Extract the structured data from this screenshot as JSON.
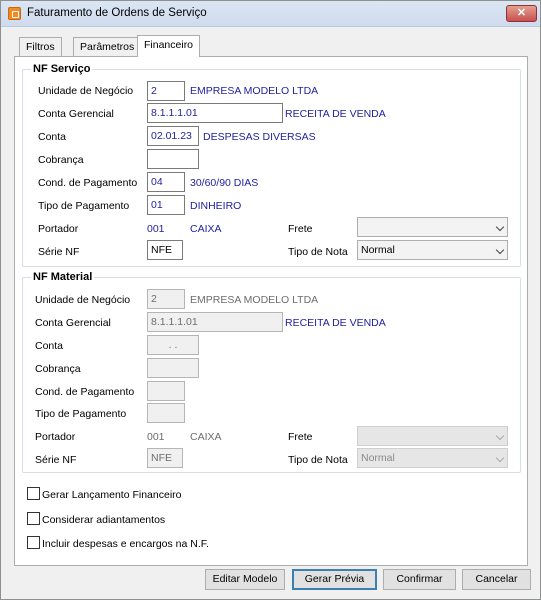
{
  "window": {
    "title": "Faturamento de Ordens de Serviço",
    "close_label": "✕"
  },
  "tabs": [
    {
      "label": "Filtros"
    },
    {
      "label": "Parâmetros"
    },
    {
      "label": "Financeiro",
      "active": true
    }
  ],
  "nf_servico": {
    "title": "NF Serviço",
    "unidade_label": "Unidade de Negócio",
    "unidade_value": "2",
    "unidade_desc": "EMPRESA MODELO LTDA",
    "conta_gerencial_label": "Conta Gerencial",
    "conta_gerencial_value": "8.1.1.1.01",
    "conta_gerencial_desc": "RECEITA DE VENDA",
    "conta_label": "Conta",
    "conta_value": "02.01.23",
    "conta_desc": "DESPESAS DIVERSAS",
    "cobranca_label": "Cobrança",
    "cobranca_value": "",
    "cond_pag_label": "Cond. de Pagamento",
    "cond_pag_value": "04",
    "cond_pag_desc": "30/60/90 DIAS",
    "tipo_pag_label": "Tipo de Pagamento",
    "tipo_pag_value": "01",
    "tipo_pag_desc": "DINHEIRO",
    "portador_label": "Portador",
    "portador_value": "001",
    "portador_desc": "CAIXA",
    "frete_label": "Frete",
    "frete_value": "",
    "serie_label": "Série NF",
    "serie_value": "NFE",
    "tipo_nota_label": "Tipo de Nota",
    "tipo_nota_value": "Normal"
  },
  "nf_material": {
    "title": "NF Material",
    "unidade_label": "Unidade de Negócio",
    "unidade_value": "2",
    "unidade_desc": "EMPRESA MODELO LTDA",
    "conta_gerencial_label": "Conta Gerencial",
    "conta_gerencial_value": "8.1.1.1.01",
    "conta_gerencial_desc": "RECEITA DE VENDA",
    "conta_label": "Conta",
    "conta_value": ". .",
    "cobranca_label": "Cobrança",
    "cobranca_value": "",
    "cond_pag_label": "Cond. de Pagamento",
    "cond_pag_value": "",
    "tipo_pag_label": "Tipo de Pagamento",
    "tipo_pag_value": "",
    "portador_label": "Portador",
    "portador_value": "001",
    "portador_desc": "CAIXA",
    "frete_label": "Frete",
    "frete_value": "",
    "serie_label": "Série NF",
    "serie_value": "NFE",
    "tipo_nota_label": "Tipo de Nota",
    "tipo_nota_value": "Normal"
  },
  "options": {
    "gerar_lancamento": "Gerar Lançamento Financeiro",
    "considerar_adiantamentos": "Considerar adiantamentos",
    "incluir_despesas": "Incluir despesas e encargos na N.F."
  },
  "buttons": {
    "editar_modelo": "Editar Modelo",
    "gerar_previa": "Gerar Prévia",
    "confirmar": "Confirmar",
    "cancelar": "Cancelar"
  }
}
